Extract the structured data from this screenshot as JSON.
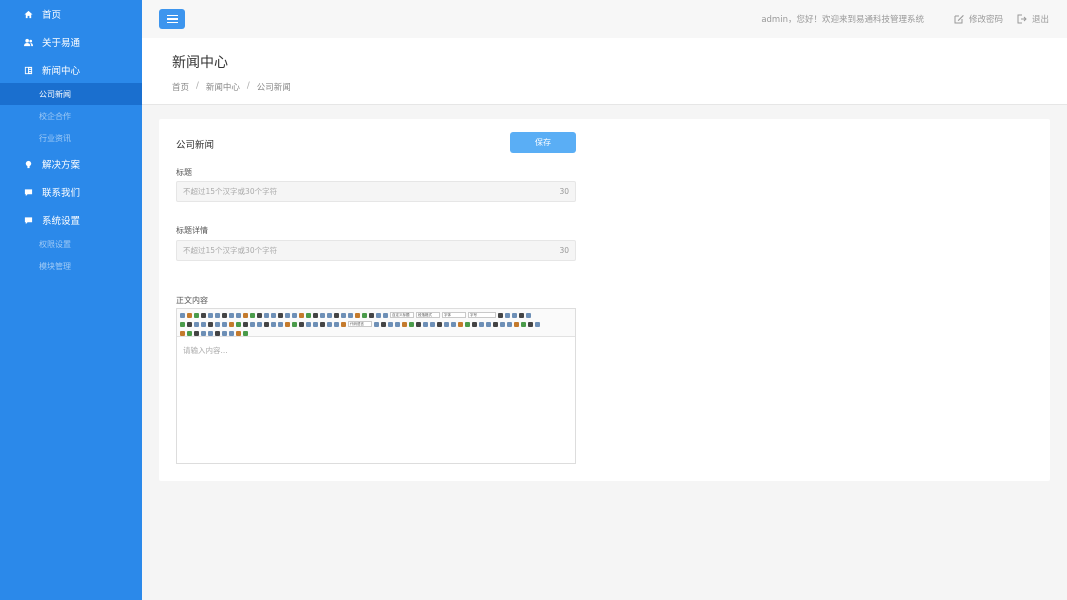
{
  "sidebar": {
    "items": [
      {
        "label": "首页",
        "icon": "home-icon"
      },
      {
        "label": "关于易通",
        "icon": "users-icon"
      },
      {
        "label": "新闻中心",
        "icon": "news-icon"
      },
      {
        "label": "解决方案",
        "icon": "bulb-icon"
      },
      {
        "label": "联系我们",
        "icon": "chat-icon"
      },
      {
        "label": "系统设置",
        "icon": "chat-icon"
      }
    ],
    "news_sub": [
      "公司新闻",
      "校企合作",
      "行业资讯"
    ],
    "settings_sub": [
      "权限设置",
      "模块管理"
    ],
    "color": "#2b89ea",
    "active_color": "#1a6fcf"
  },
  "header": {
    "welcome": "admin，您好！欢迎来到易通科技管理系统",
    "change_password": "修改密码",
    "logout": "退出"
  },
  "page": {
    "title": "新闻中心",
    "breadcrumb": [
      "首页",
      "新闻中心",
      "公司新闻"
    ]
  },
  "form": {
    "card_title": "公司新闻",
    "save_label": "保存",
    "title_label": "标题",
    "title_placeholder": "不超过15个汉字或30个字符",
    "title_count": "30",
    "detail_label": "标题详情",
    "detail_placeholder": "不超过15个汉字或30个字符",
    "detail_count": "30",
    "content_label": "正文内容",
    "content_placeholder": "请输入内容...",
    "toolbar_selects": [
      "自定义标题",
      "段落格式",
      "字体",
      "字号",
      "代码语言"
    ]
  }
}
